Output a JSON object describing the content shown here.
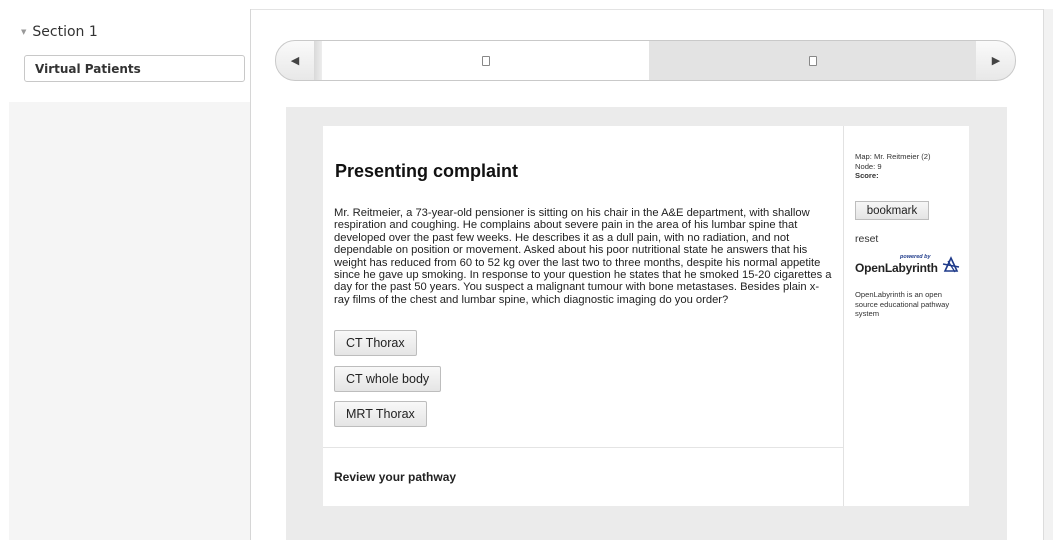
{
  "sidebar": {
    "section_label": "Section 1",
    "item_label": "Virtual Patients"
  },
  "carousel": {
    "prev_icon": "triangle-left-icon",
    "next_icon": "triangle-right-icon",
    "slide_icon": "document-icon"
  },
  "node": {
    "title": "Presenting complaint",
    "text": "Mr. Reitmeier, a 73-year-old pensioner is sitting on his chair in the A&E department, with shallow respiration and coughing. He complains about severe pain in the area of his lumbar spine that developed over the past few weeks. He describes it as a dull pain, with no radiation, and not dependable on position or movement. Asked about his poor nutritional state he answers that his weight has reduced from 60 to 52 kg over the last two to three months, despite his normal appetite since he gave up smoking. In response to your question he states that he smoked 15-20 cigarettes a day for the past 50 years. You suspect a malignant tumour with bone metastases. Besides plain x-ray films of the chest and lumbar spine, which diagnostic imaging do you order?",
    "answers": [
      "CT Thorax",
      "CT whole body",
      "MRT Thorax"
    ],
    "review_label": "Review your pathway"
  },
  "side": {
    "map_line": "Map: Mr. Reitmeier (2)",
    "node_line": "Node: 9",
    "score_label": "Score:",
    "bookmark_label": "bookmark",
    "reset_label": "reset",
    "logo_powered": "powered by",
    "logo_name": "OpenLabyrinth",
    "about": "OpenLabyrinth is an open source educational pathway system"
  }
}
